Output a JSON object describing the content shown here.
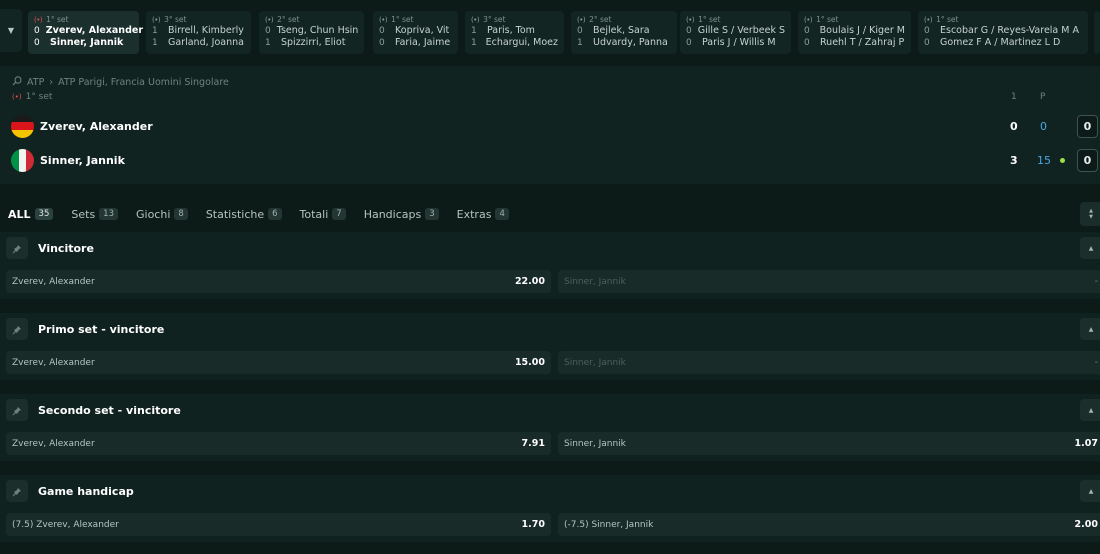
{
  "live_strip": {
    "matches": [
      {
        "status": "1° set",
        "p1_score": "0",
        "p1": "Zverev, Alexander",
        "p2_score": "0",
        "p2": "Sinner, Jannik",
        "active": true
      },
      {
        "status": "3° set",
        "p1_score": "1",
        "p1": "Birrell, Kimberly",
        "p2_score": "1",
        "p2": "Garland, Joanna"
      },
      {
        "status": "2° set",
        "p1_score": "0",
        "p1": "Tseng, Chun Hsin",
        "p2_score": "1",
        "p2": "Spizzirri, Eliot"
      },
      {
        "status": "1° set",
        "p1_score": "0",
        "p1": "Kopriva, Vit",
        "p2_score": "0",
        "p2": "Faria, Jaime"
      },
      {
        "status": "3° set",
        "p1_score": "1",
        "p1": "Paris, Tom",
        "p2_score": "1",
        "p2": "Echargui, Moez"
      },
      {
        "status": "2° set",
        "p1_score": "0",
        "p1": "Bejlek, Sara",
        "p2_score": "1",
        "p2": "Udvardy, Panna"
      },
      {
        "status": "1° set",
        "p1_score": "0",
        "p1": "Gille S / Verbeek S",
        "p2_score": "0",
        "p2": "Paris J / Willis M"
      },
      {
        "status": "1° set",
        "p1_score": "0",
        "p1": "Boulais J / Kiger M",
        "p2_score": "0",
        "p2": "Ruehl T / Zahraj P"
      },
      {
        "status": "1° set",
        "p1_score": "0",
        "p1": "Escobar G / Reyes-Varela M A",
        "p2_score": "0",
        "p2": "Gomez F A / Martinez L D"
      }
    ]
  },
  "match": {
    "breadcrumb_sport": "ATP",
    "breadcrumb_event": "ATP Parigi, Francia Uomini Singolare",
    "set_status": "1° set",
    "col_set": "1",
    "col_points": "P",
    "players": [
      {
        "name": "Zverev, Alexander",
        "games": "0",
        "points": "0",
        "set": "0",
        "serving": false
      },
      {
        "name": "Sinner, Jannik",
        "games": "3",
        "points": "15",
        "set": "0",
        "serving": true
      }
    ]
  },
  "tabs": [
    {
      "label": "ALL",
      "count": "35",
      "active": true
    },
    {
      "label": "Sets",
      "count": "13"
    },
    {
      "label": "Giochi",
      "count": "8"
    },
    {
      "label": "Statistiche",
      "count": "6"
    },
    {
      "label": "Totali",
      "count": "7"
    },
    {
      "label": "Handicaps",
      "count": "3"
    },
    {
      "label": "Extras",
      "count": "4"
    }
  ],
  "markets": [
    {
      "title": "Vincitore",
      "left": {
        "label": "Zverev, Alexander",
        "odd": "22.00",
        "enabled": true
      },
      "right": {
        "label": "Sinner, Jannik",
        "odd": "-",
        "enabled": false
      }
    },
    {
      "title": "Primo set - vincitore",
      "left": {
        "label": "Zverev, Alexander",
        "odd": "15.00",
        "enabled": true
      },
      "right": {
        "label": "Sinner, Jannik",
        "odd": "-",
        "enabled": false
      }
    },
    {
      "title": "Secondo set - vincitore",
      "left": {
        "label": "Zverev, Alexander",
        "odd": "7.91",
        "enabled": true
      },
      "right": {
        "label": "Sinner, Jannik",
        "odd": "1.07",
        "enabled": true
      }
    },
    {
      "title": "Game handicap",
      "left": {
        "label": "(7.5) Zverev, Alexander",
        "odd": "1.70",
        "enabled": true
      },
      "right": {
        "label": "(-7.5) Sinner, Jannik",
        "odd": "2.00",
        "enabled": true
      }
    }
  ],
  "colors": {
    "accent_live": "#e25050",
    "points_blue": "#4aa7e6",
    "serve_green": "#9be04a"
  }
}
